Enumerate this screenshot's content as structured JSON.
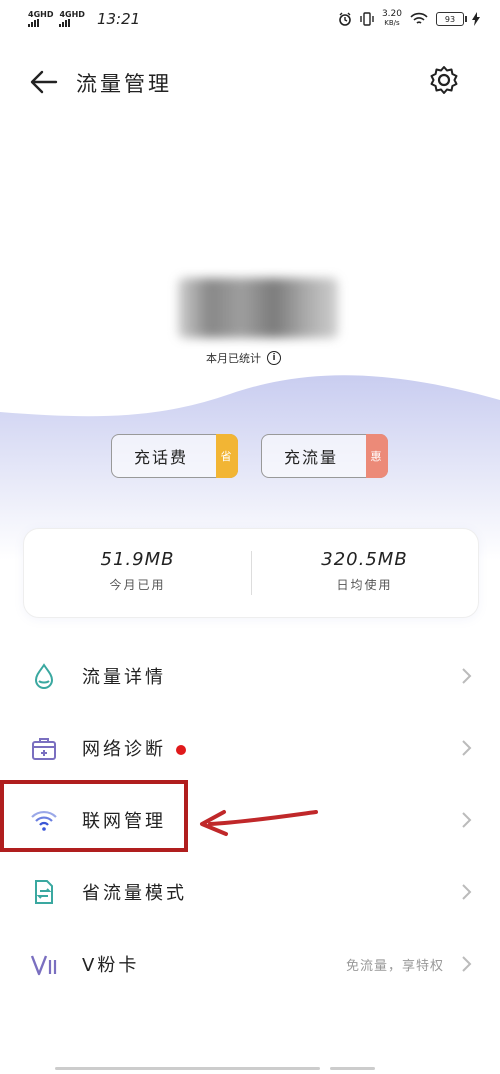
{
  "status_bar": {
    "sim1": "4GHD",
    "sim2": "4GHD",
    "time": "13:21",
    "speed_value": "3.20",
    "speed_unit": "KB/s",
    "battery": "93"
  },
  "header": {
    "title": "流量管理"
  },
  "summary": {
    "stat_label": "本月已统计"
  },
  "buttons": {
    "recharge_fee": "充话费",
    "recharge_fee_tag": "省",
    "recharge_data": "充流量",
    "recharge_data_tag": "惠"
  },
  "usage": {
    "today_value": "51.9MB",
    "today_label": "今月已用",
    "avg_value": "320.5MB",
    "avg_label": "日均使用"
  },
  "menu": [
    {
      "label": "流量详情",
      "icon": "water-drop-icon"
    },
    {
      "label": "网络诊断",
      "icon": "toolbox-icon"
    },
    {
      "label": "联网管理",
      "icon": "wifi-icon"
    },
    {
      "label": "省流量模式",
      "icon": "data-saver-icon"
    },
    {
      "label": "V粉卡",
      "icon": "v-card-icon",
      "hint": "免流量，享特权"
    }
  ],
  "colors": {
    "accent_teal": "#3aa8a0",
    "accent_purple": "#7a6fc0",
    "tag_yellow": "#f2b534",
    "tag_red": "#ec8a78",
    "highlight_red": "#b01e1e",
    "badge_red": "#e0191b"
  }
}
